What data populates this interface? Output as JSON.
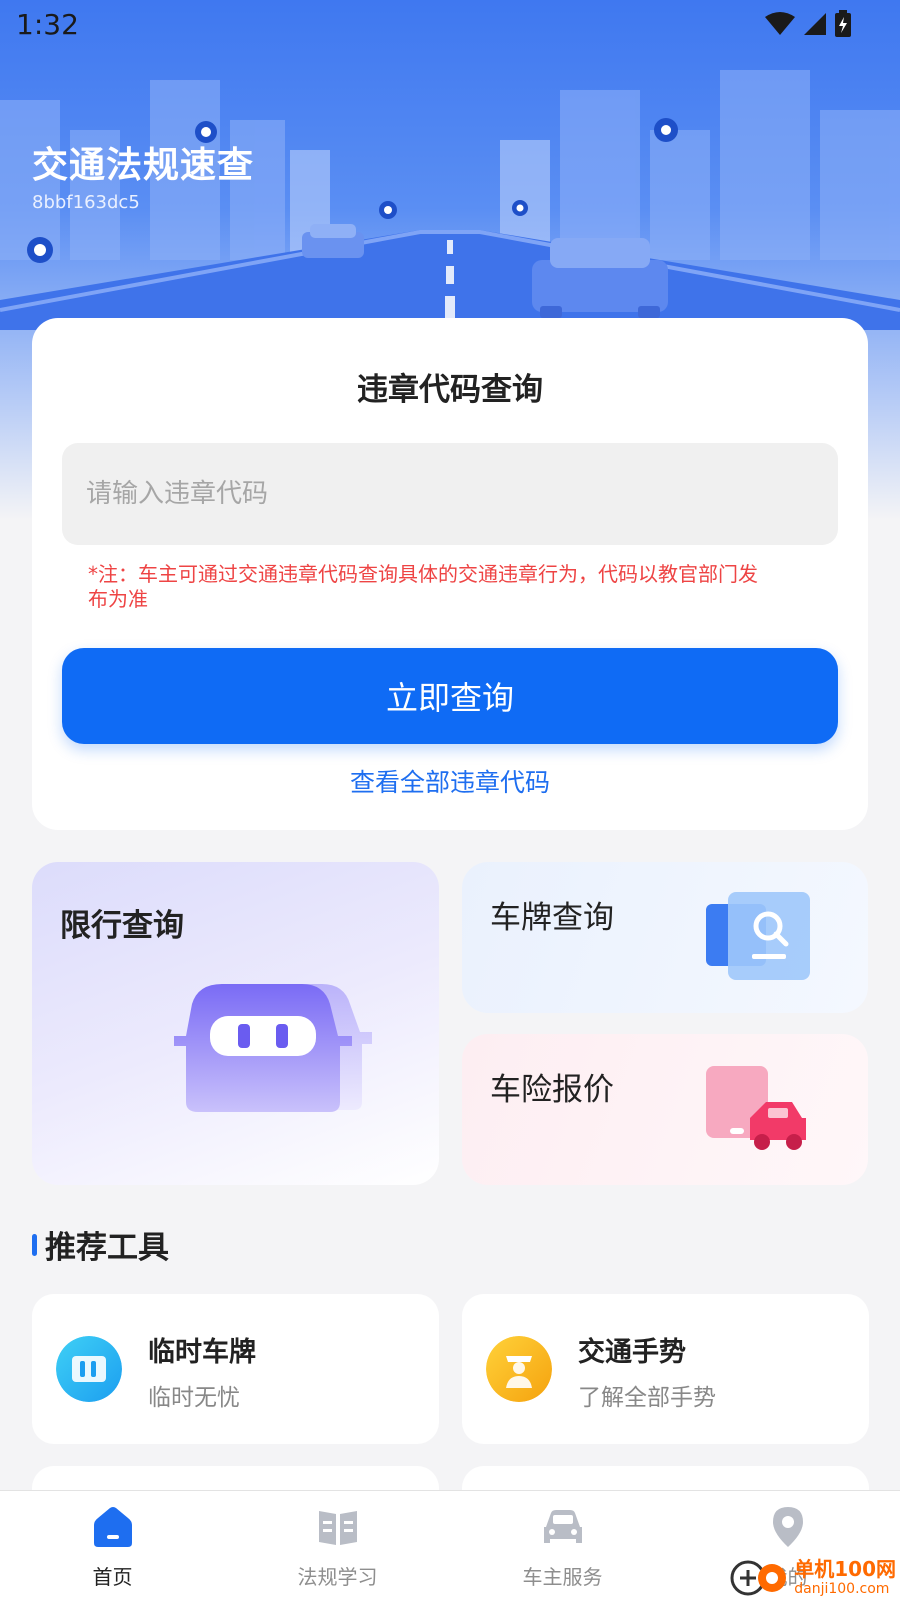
{
  "status_bar": {
    "time": "1:32"
  },
  "header": {
    "title": "交通法规速查",
    "id_text": "8bbf163dc5"
  },
  "query_card": {
    "title": "违章代码查询",
    "input_placeholder": "请输入违章代码",
    "input_value": "",
    "note": "*注：车主可通过交通违章代码查询具体的交通违章行为，代码以教官部门发布为准",
    "submit_label": "立即查询",
    "all_codes_link": "查看全部违章代码"
  },
  "features": {
    "limit": "限行查询",
    "plate": "车牌查询",
    "insurance": "车险报价"
  },
  "section": {
    "title": "推荐工具"
  },
  "tools": [
    {
      "name": "临时车牌",
      "desc": "临时无忧",
      "icon": "temp-plate-icon"
    },
    {
      "name": "交通手势",
      "desc": "了解全部手势",
      "icon": "traffic-police-icon"
    }
  ],
  "tabbar": [
    {
      "label": "首页",
      "icon": "home-icon",
      "active": true
    },
    {
      "label": "法规学习",
      "icon": "book-icon",
      "active": false
    },
    {
      "label": "车主服务",
      "icon": "car-icon",
      "active": false
    },
    {
      "label": "我的",
      "icon": "location-pin-icon",
      "active": false
    }
  ],
  "watermark": {
    "name": "单机100网",
    "url": "danji100.com"
  },
  "colors": {
    "primary": "#0f6bf5",
    "note_red": "#ee4444",
    "link_blue": "#1e6ef0",
    "watermark_orange": "#ff6a00"
  }
}
